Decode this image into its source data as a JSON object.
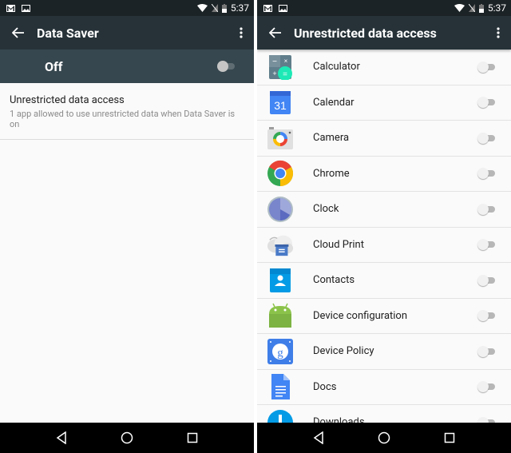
{
  "status_bar": {
    "time": "5:37",
    "left_icons": [
      "gmail-icon",
      "photo-icon"
    ],
    "right_icons": [
      "wifi-icon",
      "no-sim-icon",
      "battery-icon"
    ]
  },
  "left_screen": {
    "toolbar": {
      "title": "Data Saver",
      "back_icon": "arrow-back-icon",
      "more_icon": "more-vert-icon"
    },
    "master_switch": {
      "label": "Off",
      "state": "off"
    },
    "preference": {
      "title": "Unrestricted data access",
      "summary": "1 app allowed to use unrestricted data when Data Saver is on"
    }
  },
  "right_screen": {
    "toolbar": {
      "title": "Unrestricted data access",
      "back_icon": "arrow-back-icon",
      "more_icon": "more-vert-icon"
    },
    "apps": [
      {
        "name": "Calculator",
        "icon": "calculator-icon",
        "enabled": false
      },
      {
        "name": "Calendar",
        "icon": "calendar-icon",
        "icon_text": "31",
        "enabled": false
      },
      {
        "name": "Camera",
        "icon": "camera-icon",
        "enabled": false
      },
      {
        "name": "Chrome",
        "icon": "chrome-icon",
        "enabled": false
      },
      {
        "name": "Clock",
        "icon": "clock-icon",
        "enabled": false
      },
      {
        "name": "Cloud Print",
        "icon": "cloud-print-icon",
        "enabled": false
      },
      {
        "name": "Contacts",
        "icon": "contacts-icon",
        "enabled": false
      },
      {
        "name": "Device configuration",
        "icon": "android-icon",
        "enabled": false
      },
      {
        "name": "Device Policy",
        "icon": "device-policy-icon",
        "icon_text": "g",
        "enabled": false
      },
      {
        "name": "Docs",
        "icon": "docs-icon",
        "enabled": false
      },
      {
        "name": "Downloads",
        "icon": "downloads-icon",
        "enabled": false
      }
    ]
  },
  "nav_bar": {
    "back": "back-triangle-icon",
    "home": "home-circle-icon",
    "recents": "recents-square-icon"
  }
}
